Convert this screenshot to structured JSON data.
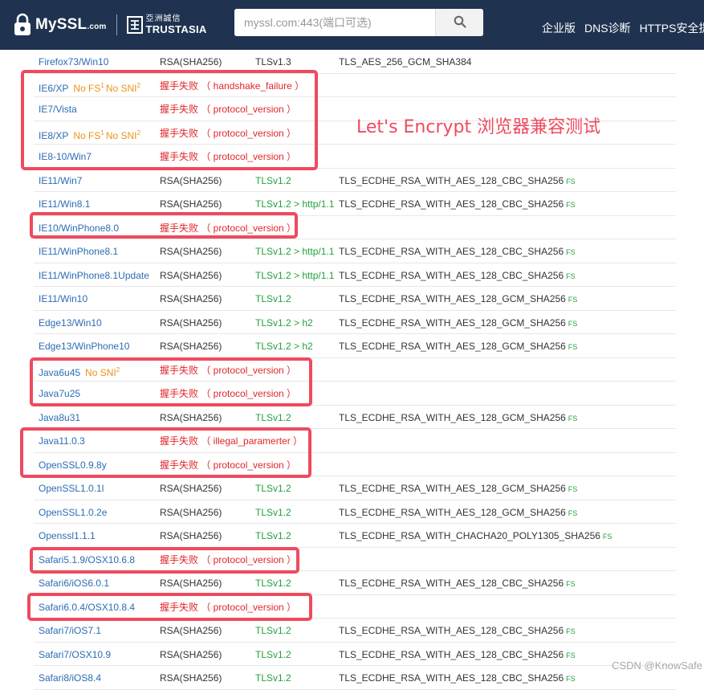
{
  "header": {
    "logo_text": "MySSL",
    "logo_suffix": ".com",
    "partner_cn": "亞洲誠信",
    "partner_en": "TRUSTASIA",
    "search_placeholder": "myssl.com:443(端口可选)",
    "nav": [
      "企业版",
      "DNS诊断",
      "HTTPS安全提"
    ]
  },
  "annotation": "Let's Encrypt 浏览器兼容测试",
  "watermark": "CSDN @KnowSafe",
  "rows": [
    {
      "client": "Firefox73/Win10",
      "notes": [],
      "cert": "RSA(SHA256)",
      "protocol": "TLSv1.3",
      "protocol_green": false,
      "cipher": "TLS_AES_256_GCM_SHA384",
      "fs": ""
    },
    {
      "client": "IE6/XP",
      "notes": [
        {
          "text": "No FS",
          "sup": "1"
        },
        {
          "text": "No SNI",
          "sup": "2"
        }
      ],
      "error": "握手失败 （ handshake_failure ）"
    },
    {
      "client": "IE7/Vista",
      "notes": [],
      "error": "握手失败 （ protocol_version ）"
    },
    {
      "client": "IE8/XP",
      "notes": [
        {
          "text": "No FS",
          "sup": "1"
        },
        {
          "text": "No SNI",
          "sup": "2"
        }
      ],
      "error": "握手失败 （ protocol_version ）"
    },
    {
      "client": "IE8-10/Win7",
      "notes": [],
      "error": "握手失败 （ protocol_version ）"
    },
    {
      "client": "IE11/Win7",
      "notes": [],
      "cert": "RSA(SHA256)",
      "protocol": "TLSv1.2",
      "protocol_green": true,
      "cipher": "TLS_ECDHE_RSA_WITH_AES_128_CBC_SHA256",
      "fs": "FS"
    },
    {
      "client": "IE11/Win8.1",
      "notes": [],
      "cert": "RSA(SHA256)",
      "protocol": "TLSv1.2 > http/1.1",
      "protocol_green": true,
      "cipher": "TLS_ECDHE_RSA_WITH_AES_128_CBC_SHA256",
      "fs": "FS"
    },
    {
      "client": "IE10/WinPhone8.0",
      "notes": [],
      "error": "握手失败 （ protocol_version ）"
    },
    {
      "client": "IE11/WinPhone8.1",
      "notes": [],
      "cert": "RSA(SHA256)",
      "protocol": "TLSv1.2 > http/1.1",
      "protocol_green": true,
      "cipher": "TLS_ECDHE_RSA_WITH_AES_128_CBC_SHA256",
      "fs": "FS"
    },
    {
      "client": "IE11/WinPhone8.1Update",
      "notes": [],
      "cert": "RSA(SHA256)",
      "protocol": "TLSv1.2 > http/1.1",
      "protocol_green": true,
      "cipher": "TLS_ECDHE_RSA_WITH_AES_128_CBC_SHA256",
      "fs": "FS"
    },
    {
      "client": "IE11/Win10",
      "notes": [],
      "cert": "RSA(SHA256)",
      "protocol": "TLSv1.2",
      "protocol_green": true,
      "cipher": "TLS_ECDHE_RSA_WITH_AES_128_GCM_SHA256",
      "fs": "FS"
    },
    {
      "client": "Edge13/Win10",
      "notes": [],
      "cert": "RSA(SHA256)",
      "protocol": "TLSv1.2 > h2",
      "protocol_green": true,
      "cipher": "TLS_ECDHE_RSA_WITH_AES_128_GCM_SHA256",
      "fs": "FS"
    },
    {
      "client": "Edge13/WinPhone10",
      "notes": [],
      "cert": "RSA(SHA256)",
      "protocol": "TLSv1.2 > h2",
      "protocol_green": true,
      "cipher": "TLS_ECDHE_RSA_WITH_AES_128_GCM_SHA256",
      "fs": "FS"
    },
    {
      "client": "Java6u45",
      "notes": [
        {
          "text": "No SNI",
          "sup": "2"
        }
      ],
      "error": "握手失败 （ protocol_version ）"
    },
    {
      "client": "Java7u25",
      "notes": [],
      "error": "握手失败 （ protocol_version ）"
    },
    {
      "client": "Java8u31",
      "notes": [],
      "cert": "RSA(SHA256)",
      "protocol": "TLSv1.2",
      "protocol_green": true,
      "cipher": "TLS_ECDHE_RSA_WITH_AES_128_GCM_SHA256",
      "fs": "FS"
    },
    {
      "client": "Java11.0.3",
      "notes": [],
      "error": "握手失败 （ illegal_paramerter ）"
    },
    {
      "client": "OpenSSL0.9.8y",
      "notes": [],
      "error": "握手失败 （ protocol_version ）"
    },
    {
      "client": "OpenSSL1.0.1l",
      "notes": [],
      "cert": "RSA(SHA256)",
      "protocol": "TLSv1.2",
      "protocol_green": true,
      "cipher": "TLS_ECDHE_RSA_WITH_AES_128_GCM_SHA256",
      "fs": "FS"
    },
    {
      "client": "OpenSSL1.0.2e",
      "notes": [],
      "cert": "RSA(SHA256)",
      "protocol": "TLSv1.2",
      "protocol_green": true,
      "cipher": "TLS_ECDHE_RSA_WITH_AES_128_GCM_SHA256",
      "fs": "FS"
    },
    {
      "client": "Openssl1.1.1",
      "notes": [],
      "cert": "RSA(SHA256)",
      "protocol": "TLSv1.2",
      "protocol_green": true,
      "cipher": "TLS_ECDHE_RSA_WITH_CHACHA20_POLY1305_SHA256",
      "fs": "FS"
    },
    {
      "client": "Safari5.1.9/OSX10.6.8",
      "notes": [],
      "error": "握手失败 （ protocol_version ）"
    },
    {
      "client": "Safari6/iOS6.0.1",
      "notes": [],
      "cert": "RSA(SHA256)",
      "protocol": "TLSv1.2",
      "protocol_green": true,
      "cipher": "TLS_ECDHE_RSA_WITH_AES_128_CBC_SHA256",
      "fs": "FS"
    },
    {
      "client": "Safari6.0.4/OSX10.8.4",
      "notes": [],
      "error": "握手失败 （ protocol_version ）"
    },
    {
      "client": "Safari7/iOS7.1",
      "notes": [],
      "cert": "RSA(SHA256)",
      "protocol": "TLSv1.2",
      "protocol_green": true,
      "cipher": "TLS_ECDHE_RSA_WITH_AES_128_CBC_SHA256",
      "fs": "FS"
    },
    {
      "client": "Safari7/OSX10.9",
      "notes": [],
      "cert": "RSA(SHA256)",
      "protocol": "TLSv1.2",
      "protocol_green": true,
      "cipher": "TLS_ECDHE_RSA_WITH_AES_128_CBC_SHA256",
      "fs": "FS"
    },
    {
      "client": "Safari8/iOS8.4",
      "notes": [],
      "cert": "RSA(SHA256)",
      "protocol": "TLSv1.2",
      "protocol_green": true,
      "cipher": "TLS_ECDHE_RSA_WITH_AES_128_CBC_SHA256",
      "fs": "FS"
    }
  ]
}
